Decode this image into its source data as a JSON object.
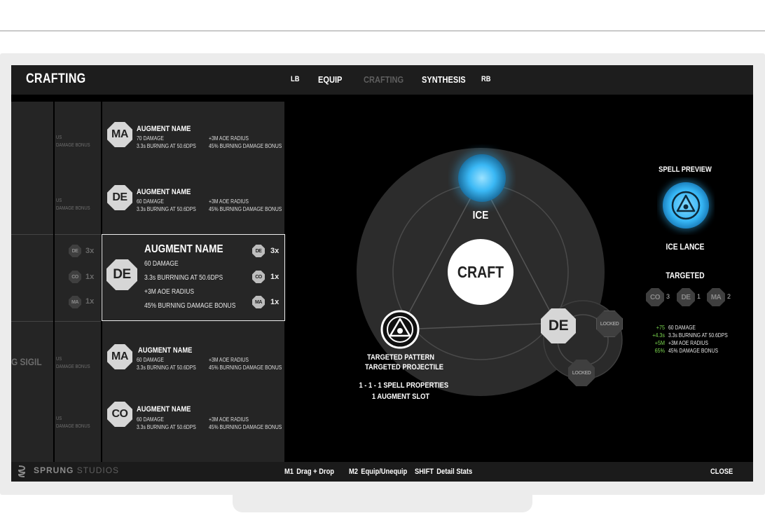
{
  "header": {
    "title": "CRAFTING",
    "nav_left_bumper": "LB",
    "tabs": [
      {
        "label": "EQUIP",
        "active": false
      },
      {
        "label": "CRAFTING",
        "active": true
      },
      {
        "label": "SYNTHESIS",
        "active": false
      }
    ],
    "nav_right_bumper": "RB"
  },
  "left_columns": {
    "fragment_text_1": "US",
    "fragment_text_2": "DAMAGE BONUS",
    "sigil_fragment": "G SIGIL"
  },
  "augments": [
    {
      "badge": "MA",
      "name": "AUGMENT NAME",
      "damage": "70 DAMAGE",
      "burn": "3.3s BURNING AT 50.6DPS",
      "radius": "+3M AOE RADIUS",
      "bonus": "45% BURNING DAMAGE BONUS"
    },
    {
      "badge": "DE",
      "name": "AUGMENT NAME",
      "damage": "60 DAMAGE",
      "burn": "3.3s BURNING AT 50.6DPS",
      "radius": "+3M AOE RADIUS",
      "bonus": "45% BURNING DAMAGE BONUS"
    },
    {
      "badge": "MA",
      "name": "AUGMENT NAME",
      "damage": "60 DAMAGE",
      "burn": "3.3s BURNING AT 50.6DPS",
      "radius": "+3M AOE RADIUS",
      "bonus": "45% BURNING DAMAGE BONUS"
    },
    {
      "badge": "CO",
      "name": "AUGMENT NAME",
      "damage": "60 DAMAGE",
      "burn": "3.3s BURNING AT 50.6DPS",
      "radius": "+3M AOE RADIUS",
      "bonus": "45% BURNING DAMAGE BONUS"
    }
  ],
  "selected_augment": {
    "badge": "DE",
    "name": "AUGMENT NAME",
    "lines": [
      "60 DAMAGE",
      "3.3s BURRNING AT 50.6DPS",
      "+3M AOE RADIUS",
      "45% BURNING DAMAGE BONUS"
    ],
    "components": [
      {
        "badge": "DE",
        "count": "3x"
      },
      {
        "badge": "CO",
        "count": "1x"
      },
      {
        "badge": "MA",
        "count": "1x"
      }
    ]
  },
  "crafting_wheel": {
    "top_element": "ICE",
    "center_button": "CRAFT",
    "right_slot": "DE",
    "locked_1": "LOCKED",
    "locked_2": "LOCKED",
    "pattern_title": "TARGETED PATTERN",
    "pattern_subtitle": "TARGETED PROJECTILE",
    "properties": "1 - 1 - 1 SPELL PROPERTIES",
    "augment_slots": "1 AUGMENT SLOT",
    "accent_color": "#3ab8f5"
  },
  "spell_preview": {
    "heading": "SPELL PREVIEW",
    "spell_name": "ICE LANCE",
    "type": "TARGETED",
    "components": [
      {
        "badge": "CO",
        "count": "3"
      },
      {
        "badge": "DE",
        "count": "1"
      },
      {
        "badge": "MA",
        "count": "2"
      }
    ],
    "stats": [
      {
        "delta": "+75",
        "text": "60 DAMAGE"
      },
      {
        "delta": "+4.3s",
        "text": "3.3s BURNING AT 50.6DPS"
      },
      {
        "delta": "+5M",
        "text": "+3M AOE RADIUS"
      },
      {
        "delta": "65%",
        "text": "45% DAMAGE BONUS"
      }
    ],
    "stat_color": "#7bd84f"
  },
  "footer": {
    "brand_1": "SPRUNG",
    "brand_2": "STUDIOS",
    "hints": [
      {
        "key": "M1",
        "action": "Drag + Drop"
      },
      {
        "key": "M2",
        "action": "Equip/Unequip"
      },
      {
        "key": "SHIFT",
        "action": "Detail Stats"
      }
    ],
    "close": "CLOSE"
  }
}
